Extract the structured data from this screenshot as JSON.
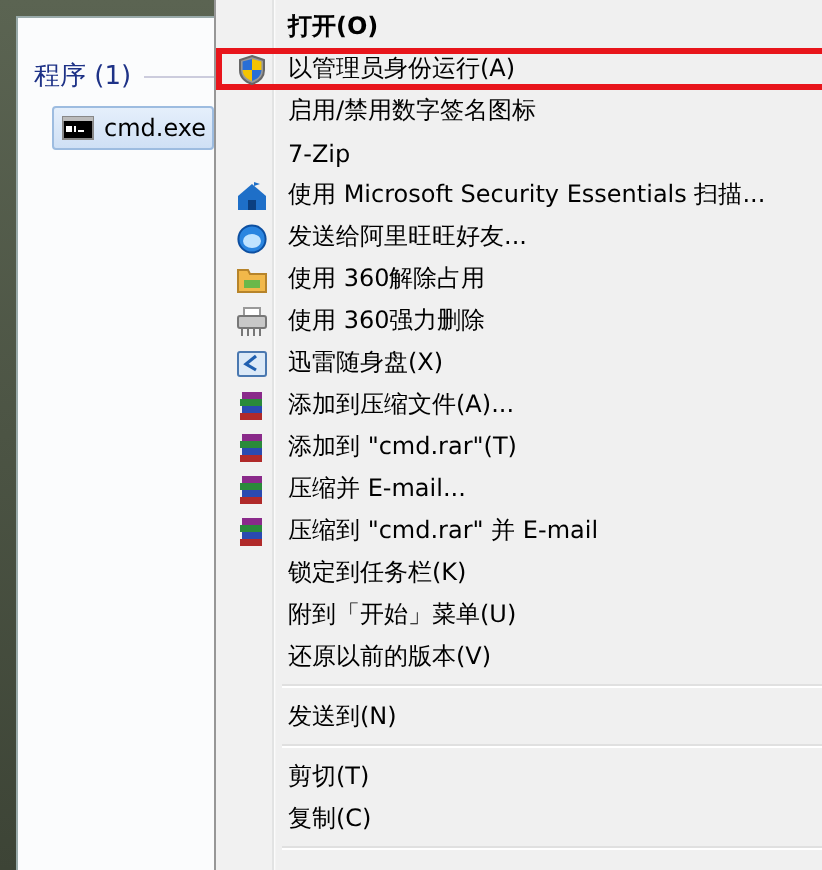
{
  "results": {
    "heading": "程序 (1)",
    "items": [
      {
        "label": "cmd.exe",
        "selected": true
      }
    ]
  },
  "menu": [
    {
      "kind": "plain",
      "label": "打开(O)",
      "bold": true,
      "highlighted": false
    },
    {
      "kind": "shield",
      "label": "以管理员身份运行(A)",
      "bold": false,
      "highlighted": true
    },
    {
      "kind": "plain",
      "label": "启用/禁用数字签名图标",
      "bold": false,
      "highlighted": false
    },
    {
      "kind": "plain",
      "label": "7-Zip",
      "bold": false,
      "highlighted": false
    },
    {
      "kind": "house",
      "label": "使用 Microsoft Security Essentials 扫描...",
      "bold": false,
      "highlighted": false
    },
    {
      "kind": "ball",
      "label": "发送给阿里旺旺好友...",
      "bold": false,
      "highlighted": false
    },
    {
      "kind": "folder",
      "label": "使用 360解除占用",
      "bold": false,
      "highlighted": false
    },
    {
      "kind": "shredder",
      "label": "使用 360强力删除",
      "bold": false,
      "highlighted": false
    },
    {
      "kind": "disk",
      "label": "迅雷随身盘(X)",
      "bold": false,
      "highlighted": false
    },
    {
      "kind": "books",
      "label": "添加到压缩文件(A)...",
      "bold": false,
      "highlighted": false
    },
    {
      "kind": "books",
      "label": "添加到 \"cmd.rar\"(T)",
      "bold": false,
      "highlighted": false
    },
    {
      "kind": "books",
      "label": "压缩并 E-mail...",
      "bold": false,
      "highlighted": false
    },
    {
      "kind": "books",
      "label": "压缩到 \"cmd.rar\" 并 E-mail",
      "bold": false,
      "highlighted": false
    },
    {
      "kind": "plain",
      "label": "锁定到任务栏(K)",
      "bold": false,
      "highlighted": false
    },
    {
      "kind": "plain",
      "label": "附到「开始」菜单(U)",
      "bold": false,
      "highlighted": false
    },
    {
      "kind": "plain",
      "label": "还原以前的版本(V)",
      "bold": false,
      "highlighted": false
    },
    {
      "kind": "separator"
    },
    {
      "kind": "plain",
      "label": "发送到(N)",
      "bold": false,
      "highlighted": false
    },
    {
      "kind": "separator"
    },
    {
      "kind": "plain",
      "label": "剪切(T)",
      "bold": false,
      "highlighted": false
    },
    {
      "kind": "plain",
      "label": "复制(C)",
      "bold": false,
      "highlighted": false
    },
    {
      "kind": "separator"
    }
  ]
}
